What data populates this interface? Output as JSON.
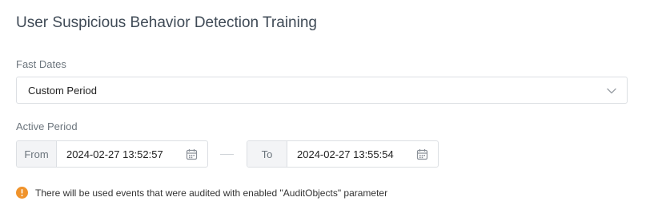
{
  "page": {
    "title": "User Suspicious Behavior Detection Training"
  },
  "fast_dates": {
    "label": "Fast Dates",
    "selected": "Custom Period"
  },
  "active_period": {
    "label": "Active Period",
    "from_label": "From",
    "from_value": "2024-02-27 13:52:57",
    "to_label": "To",
    "to_value": "2024-02-27 13:55:54"
  },
  "notice": {
    "text": "There will be used events that were audited with enabled \"AuditObjects\" parameter"
  },
  "icons": {
    "dropdown": "chevron-down-icon",
    "calendar": "calendar-icon",
    "info": "info-icon"
  },
  "colors": {
    "info_accent": "#f0932b",
    "border": "#dcdfe3",
    "addon_bg": "#f3f4f6",
    "title": "#3f4a56"
  }
}
